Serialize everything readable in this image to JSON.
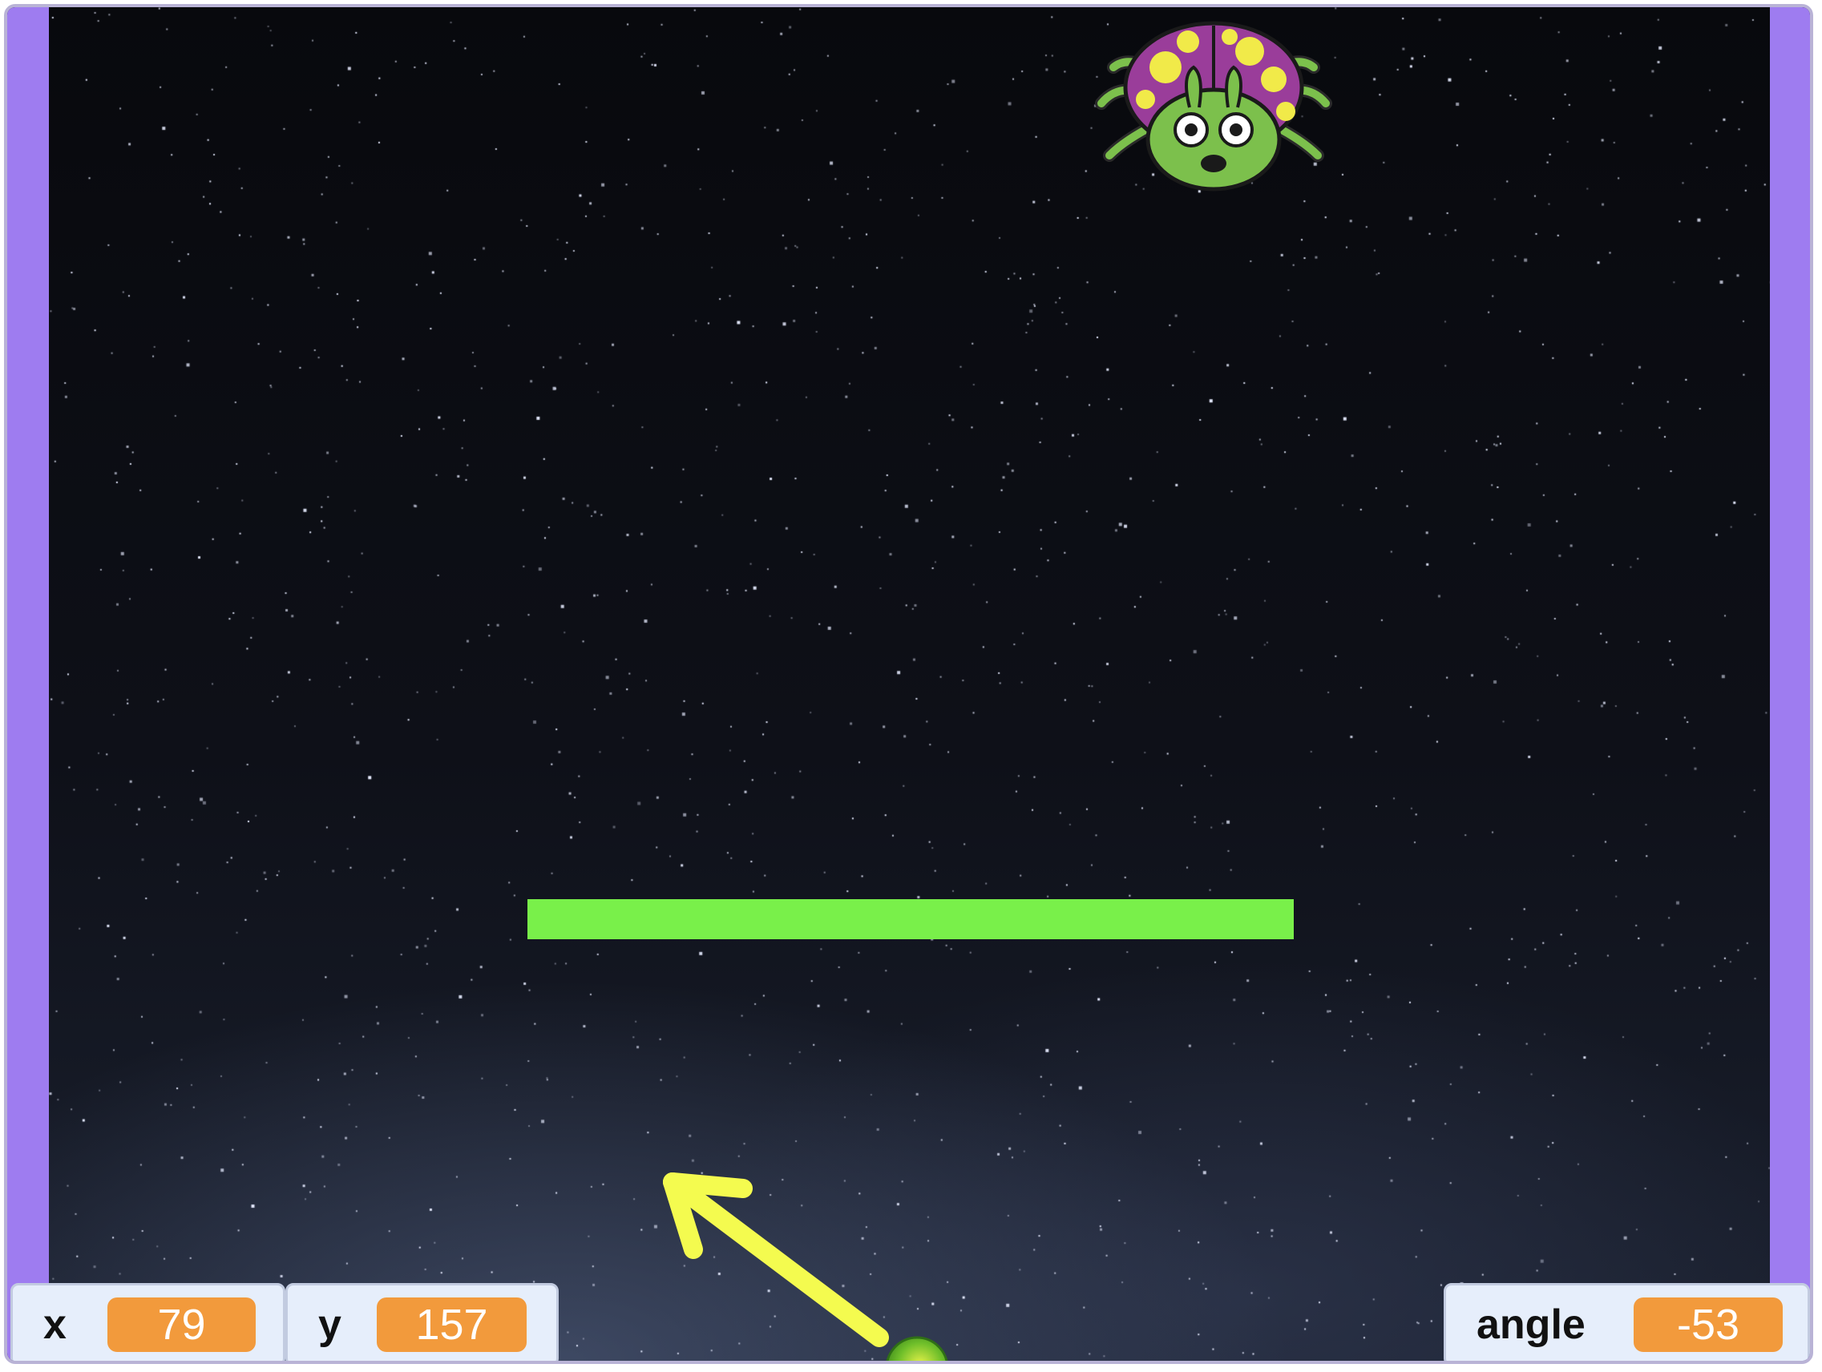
{
  "colors": {
    "frame_purple": "#9e7cf0",
    "paddle_green": "#79f04a",
    "arrow_yellow": "#f4fb4f",
    "monitor_value_orange": "#f29a3c",
    "monitor_bg": "#e6eefb"
  },
  "sprites": {
    "enemy": "spider-bug-sprite",
    "paddle": "green-bar-sprite",
    "aim_arrow": "yellow-arrow-sprite",
    "ball": "green-ball-sprite"
  },
  "monitors": {
    "x": {
      "label": "x",
      "value": "79"
    },
    "y": {
      "label": "y",
      "value": "157"
    },
    "angle": {
      "label": "angle",
      "value": "-53"
    }
  }
}
